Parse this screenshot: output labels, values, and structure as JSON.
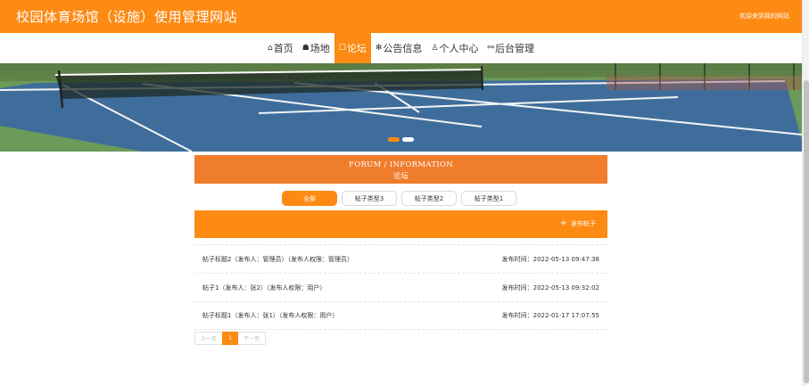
{
  "header": {
    "site_title": "校园体育场馆（设施）使用管理网站",
    "welcome": "欢迎来到我的网站"
  },
  "nav": {
    "items": [
      {
        "icon": "home-icon",
        "glyph": "⌂",
        "label": "首页"
      },
      {
        "icon": "venue-icon",
        "glyph": "☗",
        "label": "场地"
      },
      {
        "icon": "forum-icon",
        "glyph": "☐",
        "label": "论坛"
      },
      {
        "icon": "notice-icon",
        "glyph": "✻",
        "label": "公告信息"
      },
      {
        "icon": "user-icon",
        "glyph": "♙",
        "label": "个人中心"
      },
      {
        "icon": "link-icon",
        "glyph": "⚯",
        "label": "后台管理"
      }
    ],
    "active_index": 2
  },
  "banner": {
    "slides": 2,
    "active_slide": 0
  },
  "forum": {
    "title_en": "FORUM / INFORMATION",
    "title_cn": "论坛"
  },
  "categories": [
    {
      "label": "全部",
      "active": true
    },
    {
      "label": "帖子类型3",
      "active": false
    },
    {
      "label": "帖子类型2",
      "active": false
    },
    {
      "label": "帖子类型1",
      "active": false
    }
  ],
  "post_button": {
    "icon": "plus-icon",
    "label": "发布帖子"
  },
  "posts": [
    {
      "title": "帖子标题2（发布人：管理员）（发布人权限：管理员）",
      "time": "发布时间：2022-05-13 09:47:38"
    },
    {
      "title": "帖子1（发布人：张2）（发布人权限：用户）",
      "time": "发布时间：2022-05-13 09:32:02"
    },
    {
      "title": "帖子标题1（发布人：张1）（发布人权限：用户）",
      "time": "发布时间：2022-01-17 17:07:55"
    }
  ],
  "pagination": {
    "prev": "上一页",
    "current": "1",
    "next": "下一页"
  },
  "colors": {
    "brand": "#fd8a13",
    "forum_head": "#f07d2c",
    "court": "#3e6d9c",
    "court_outer": "#6f9a55"
  }
}
